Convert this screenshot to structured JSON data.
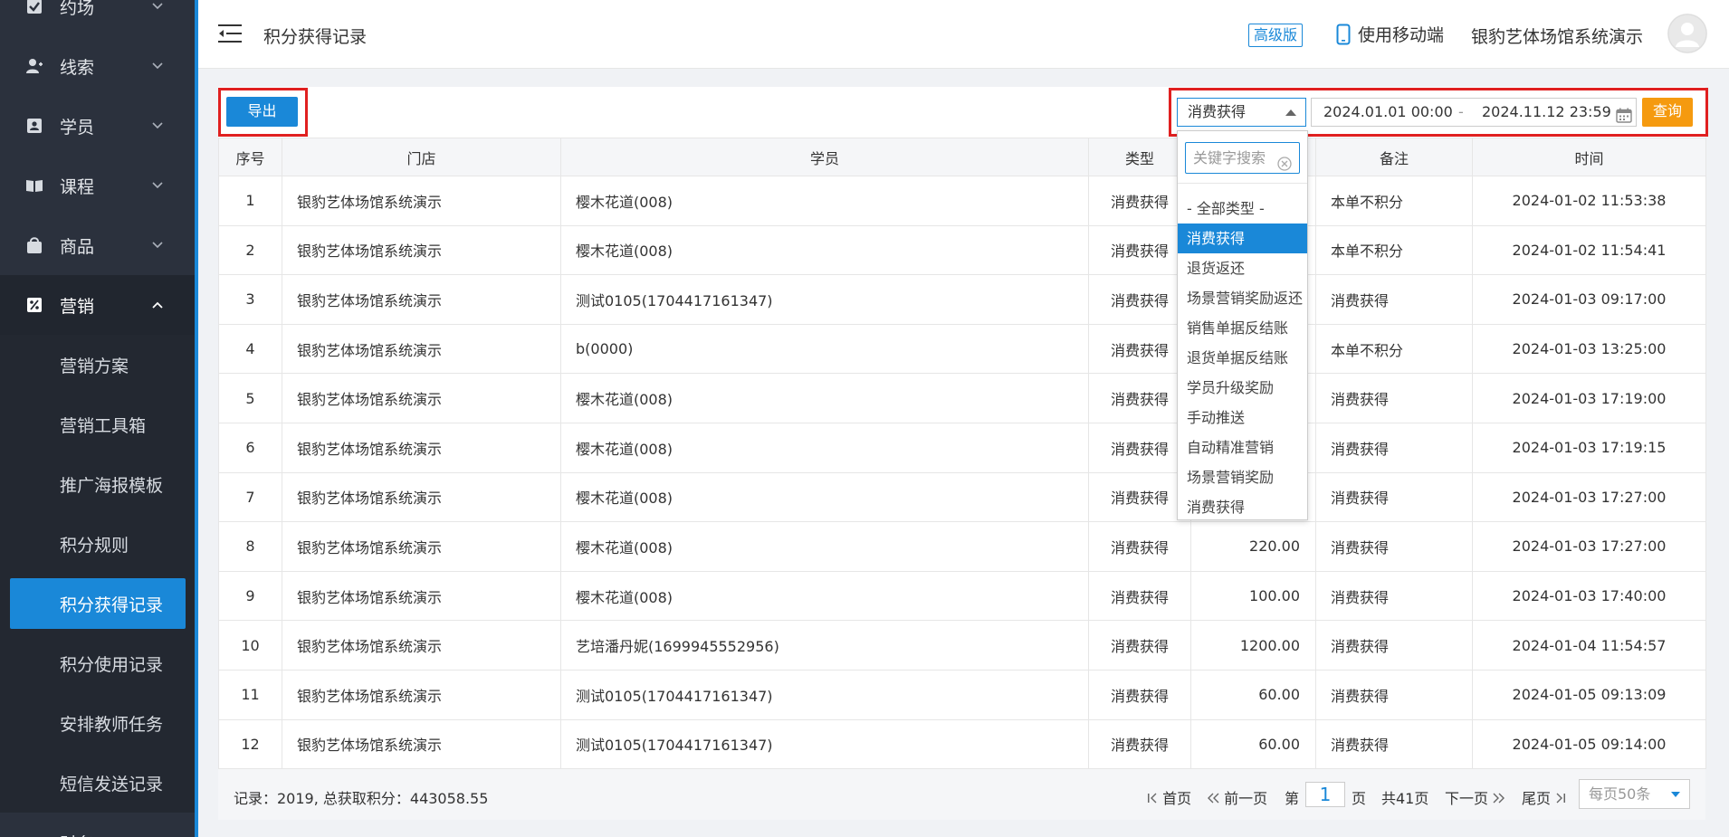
{
  "sidebar": {
    "groups": [
      {
        "label": "约场",
        "icon": "checkbox-icon"
      },
      {
        "label": "线索",
        "icon": "user-plus-icon"
      },
      {
        "label": "学员",
        "icon": "id-card-icon"
      },
      {
        "label": "课程",
        "icon": "book-icon"
      },
      {
        "label": "商品",
        "icon": "shopping-bag-icon"
      },
      {
        "label": "营销",
        "icon": "percent-icon"
      },
      {
        "label": "财务",
        "icon": "wallet-icon"
      }
    ],
    "sub_items": [
      "营销方案",
      "营销工具箱",
      "推广海报模板",
      "积分规则",
      "积分获得记录",
      "积分使用记录",
      "安排教师任务",
      "短信发送记录"
    ]
  },
  "header": {
    "title": "积分获得记录",
    "badge": "高级版",
    "mobile_link": "使用移动端",
    "org_name": "银豹艺体场馆系统演示"
  },
  "toolbar": {
    "export_label": "导出",
    "type_value": "消费获得",
    "date_start": "2024.01.01 00:00",
    "date_sep": "-",
    "date_end": "2024.11.12 23:59",
    "query_label": "查询"
  },
  "dropdown": {
    "search_placeholder": "关键字搜索",
    "options": [
      "- 全部类型 -",
      "消费获得",
      "退货返还",
      "场景营销奖励返还",
      "销售单据反结账",
      "退货单据反结账",
      "学员升级奖励",
      "手动推送",
      "自动精准营销",
      "场景营销奖励",
      "消费获得"
    ],
    "selected_index": 1
  },
  "table": {
    "columns": [
      "序号",
      "门店",
      "学员",
      "类型",
      "",
      "备注",
      "时间"
    ],
    "rows": [
      {
        "no": "1",
        "store": "银豹艺体场馆系统演示",
        "student": "樱木花道(008)",
        "type": "消费获得",
        "points": "",
        "note": "本单不积分",
        "time": "2024-01-02 11:53:38"
      },
      {
        "no": "2",
        "store": "银豹艺体场馆系统演示",
        "student": "樱木花道(008)",
        "type": "消费获得",
        "points": "",
        "note": "本单不积分",
        "time": "2024-01-02 11:54:41"
      },
      {
        "no": "3",
        "store": "银豹艺体场馆系统演示",
        "student": "测试0105(1704417161347)",
        "type": "消费获得",
        "points": "",
        "note": "消费获得",
        "time": "2024-01-03 09:17:00"
      },
      {
        "no": "4",
        "store": "银豹艺体场馆系统演示",
        "student": "b(0000)",
        "type": "消费获得",
        "points": "",
        "note": "本单不积分",
        "time": "2024-01-03 13:25:00"
      },
      {
        "no": "5",
        "store": "银豹艺体场馆系统演示",
        "student": "樱木花道(008)",
        "type": "消费获得",
        "points": "",
        "note": "消费获得",
        "time": "2024-01-03 17:19:00"
      },
      {
        "no": "6",
        "store": "银豹艺体场馆系统演示",
        "student": "樱木花道(008)",
        "type": "消费获得",
        "points": "",
        "note": "消费获得",
        "time": "2024-01-03 17:19:15"
      },
      {
        "no": "7",
        "store": "银豹艺体场馆系统演示",
        "student": "樱木花道(008)",
        "type": "消费获得",
        "points": "",
        "note": "消费获得",
        "time": "2024-01-03 17:27:00"
      },
      {
        "no": "8",
        "store": "银豹艺体场馆系统演示",
        "student": "樱木花道(008)",
        "type": "消费获得",
        "points": "220.00",
        "note": "消费获得",
        "time": "2024-01-03 17:27:00"
      },
      {
        "no": "9",
        "store": "银豹艺体场馆系统演示",
        "student": "樱木花道(008)",
        "type": "消费获得",
        "points": "100.00",
        "note": "消费获得",
        "time": "2024-01-03 17:40:00"
      },
      {
        "no": "10",
        "store": "银豹艺体场馆系统演示",
        "student": "艺培潘丹妮(1699945552956)",
        "type": "消费获得",
        "points": "1200.00",
        "note": "消费获得",
        "time": "2024-01-04 11:54:57"
      },
      {
        "no": "11",
        "store": "银豹艺体场馆系统演示",
        "student": "测试0105(1704417161347)",
        "type": "消费获得",
        "points": "60.00",
        "note": "消费获得",
        "time": "2024-01-05 09:13:09"
      },
      {
        "no": "12",
        "store": "银豹艺体场馆系统演示",
        "student": "测试0105(1704417161347)",
        "type": "消费获得",
        "points": "60.00",
        "note": "消费获得",
        "time": "2024-01-05 09:14:00"
      }
    ]
  },
  "footer": {
    "summary": "记录：2019, 总获取积分：443058.55",
    "first": "首页",
    "prev": "前一页",
    "page_prefix": "第",
    "page_value": "1",
    "page_suffix": "页",
    "total_pages": "共41页",
    "next": "下一页",
    "last": "尾页",
    "page_size": "每页50条"
  },
  "colors": {
    "primary": "#1a88d8",
    "query": "#f59a0f",
    "highlight_box": "#e02020",
    "sidebar": "#2b313d"
  }
}
